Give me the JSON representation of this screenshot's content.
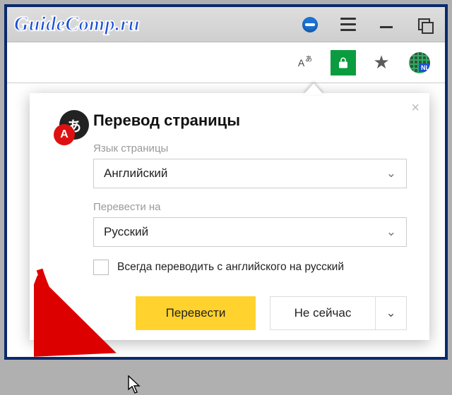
{
  "header": {
    "logo_text": "GuideComp.ru"
  },
  "toolbar": {
    "translate_indicator": "A",
    "translate_indicator_sup": "あ",
    "globe_tag": "NL"
  },
  "dialog": {
    "badge_big": "あ",
    "badge_small": "A",
    "title": "Перевод страницы",
    "source_label": "Язык страницы",
    "source_value": "Английский",
    "target_label": "Перевести на",
    "target_value": "Русский",
    "always_label": "Всегда переводить с английского на русский",
    "translate_btn": "Перевести",
    "not_now_btn": "Не сейчас"
  }
}
